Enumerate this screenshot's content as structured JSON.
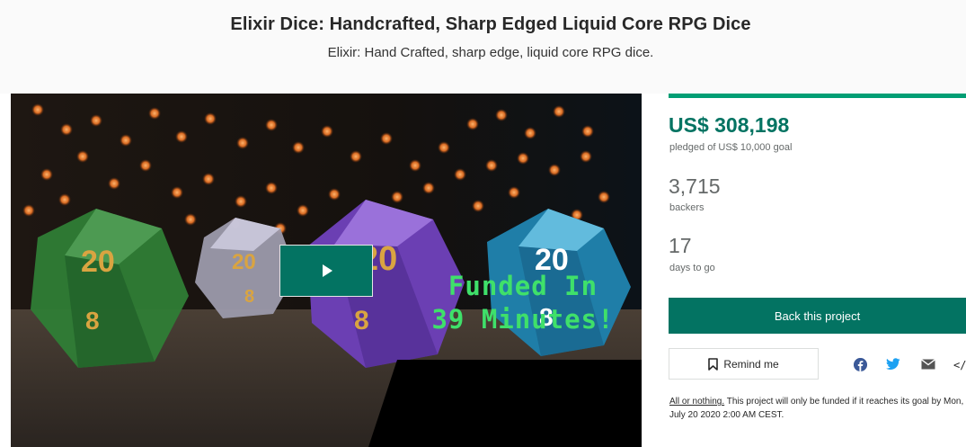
{
  "project": {
    "title": "Elixir Dice: Handcrafted, Sharp Edged Liquid Core RPG Dice",
    "blurb": "Elixir: Hand Crafted, sharp edge, liquid core RPG dice."
  },
  "video": {
    "banner_line1": "Funded In",
    "banner_line2": "39 Minutes!",
    "die_number": "20"
  },
  "stats": {
    "progress_fraction": 1.0,
    "pledged_amount": "US$ 308,198",
    "pledged_label": "pledged of US$ 10,000 goal",
    "backers_count": "3,715",
    "backers_label": "backers",
    "days_count": "17",
    "days_label": "days to go"
  },
  "actions": {
    "back_label": "Back this project",
    "remind_label": "Remind me",
    "embed_label": "</>"
  },
  "terms": {
    "link_text": "All or nothing.",
    "body_text": " This project will only be funded if it reaches its goal by Mon, July 20 2020 2:00 AM CEST."
  },
  "colors": {
    "accent": "#037362",
    "progress": "#009e74",
    "banner_text": "#3fe06a"
  },
  "icons": {
    "play": "play-icon",
    "bookmark": "bookmark-icon",
    "facebook": "facebook-icon",
    "twitter": "twitter-icon",
    "email": "email-icon",
    "embed": "embed-icon"
  }
}
